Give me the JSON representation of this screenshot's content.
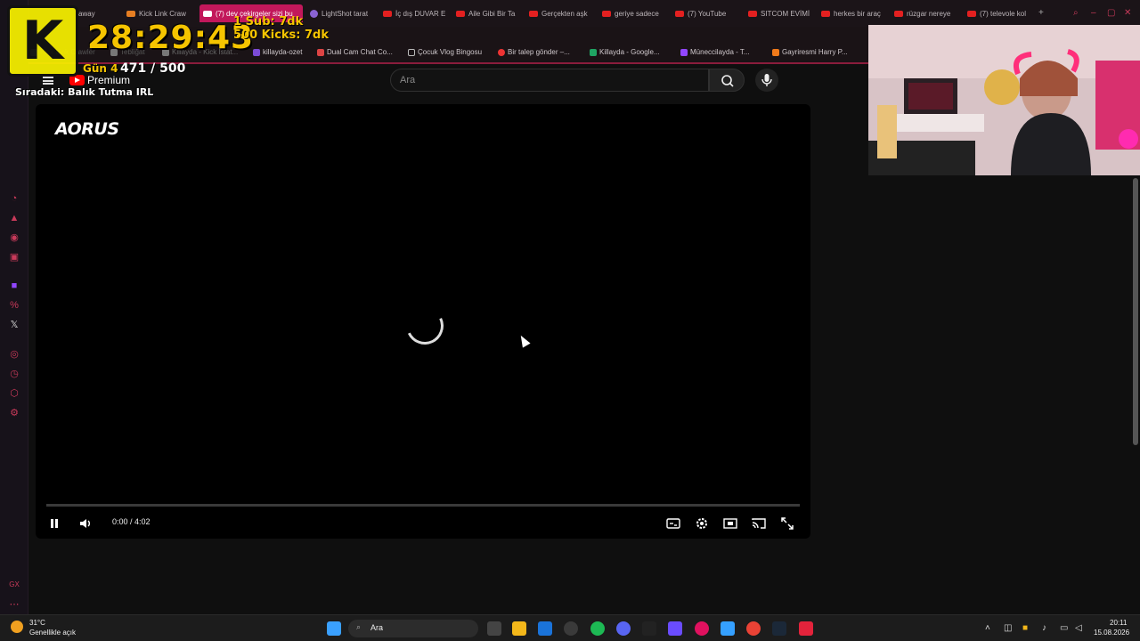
{
  "overlay": {
    "timer": "28:29:43",
    "sub_goal": "1 Sub: 7dk",
    "kick_goal": "500 Kicks: 7dk",
    "day": "Gün 4",
    "count": "471 / 500",
    "next_label": "Sıradaki: Balık Tutma IRL",
    "logo_letter": "K"
  },
  "tabs": [
    {
      "label": "away"
    },
    {
      "label": "Kick Link Craw"
    },
    {
      "label": "(7) dev çekirgeler sizi bu",
      "active": true
    },
    {
      "label": "LightShot tarat"
    },
    {
      "label": "İç dış DUVAR E"
    },
    {
      "label": "Aile Gibi Bir Ta"
    },
    {
      "label": "Gerçekten aşk"
    },
    {
      "label": "geriye sadece"
    },
    {
      "label": "(7) YouTube"
    },
    {
      "label": "SITCOM EVİMİ"
    },
    {
      "label": "herkes bir araç"
    },
    {
      "label": "rüzgar nereye"
    },
    {
      "label": "(7) televole kol"
    }
  ],
  "bookmarks": [
    {
      "label": "Kick Link Crawler"
    },
    {
      "label": "Tebliğat"
    },
    {
      "label": "Killayda - Kick İstat..."
    },
    {
      "label": "killayda-ozet"
    },
    {
      "label": "Dual Cam Chat Co..."
    },
    {
      "label": "Çocuk Vlog Bingosu"
    },
    {
      "label": "Bir talep gönder –..."
    },
    {
      "label": "Killayda - Google..."
    },
    {
      "label": "Müneccilayda - T..."
    },
    {
      "label": "Gayriresmi Harry P..."
    }
  ],
  "youtube": {
    "search_placeholder": "Ara",
    "premium_label": "Premium"
  },
  "player": {
    "brand_overlay": "AORUS",
    "time": "0:00 / 4:02",
    "progress_fraction": 0.0
  },
  "taskbar": {
    "weather_temp": "31°C",
    "weather_desc": "Genellikle açık",
    "search_label": "Ara",
    "clock_time": "20:11",
    "clock_date": "15.08.2026"
  },
  "colors": {
    "accent": "#c2185b",
    "overlay_yellow": "#f5c400",
    "youtube_red": "#ff0000"
  }
}
